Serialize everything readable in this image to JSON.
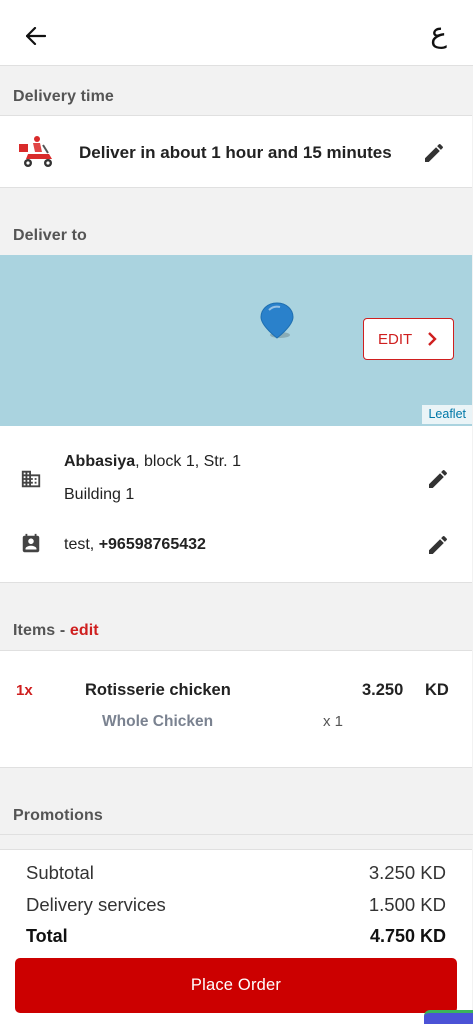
{
  "header": {
    "back_icon": "arrow-left-icon",
    "language_toggle": "ع"
  },
  "delivery_time": {
    "section_label": "Delivery time",
    "text": "Deliver in about 1 hour and 15 minutes",
    "icon": "delivery-scooter-icon",
    "edit_icon": "pencil-icon"
  },
  "deliver_to": {
    "section_label": "Deliver to",
    "map": {
      "edit_label": "EDIT",
      "attribution": "Leaflet",
      "pin_icon": "map-pin-icon"
    },
    "address": {
      "area": "Abbasiya",
      "details": ", block 1, Str. 1",
      "building": "Building 1",
      "icon": "building-icon"
    },
    "contact": {
      "name": "test, ",
      "phone": "+96598765432",
      "icon": "contact-card-icon"
    }
  },
  "items": {
    "section_label": "Items",
    "separator": " - ",
    "edit_label": "edit",
    "list": [
      {
        "qty": "1x",
        "name": "Rotisserie chicken",
        "price": "3.250",
        "currency": "KD",
        "option": "Whole Chicken",
        "option_qty": "x 1"
      }
    ]
  },
  "promotions": {
    "section_label": "Promotions"
  },
  "summary": {
    "subtotal_label": "Subtotal",
    "subtotal_value": "3.250 KD",
    "delivery_label": "Delivery services",
    "delivery_value": "1.500 KD",
    "total_label": "Total",
    "total_value": "4.750 KD"
  },
  "actions": {
    "place_order": "Place Order"
  },
  "colors": {
    "accent": "#cc0000",
    "map_water": "#aad3df",
    "pin": "#2a81cb"
  }
}
